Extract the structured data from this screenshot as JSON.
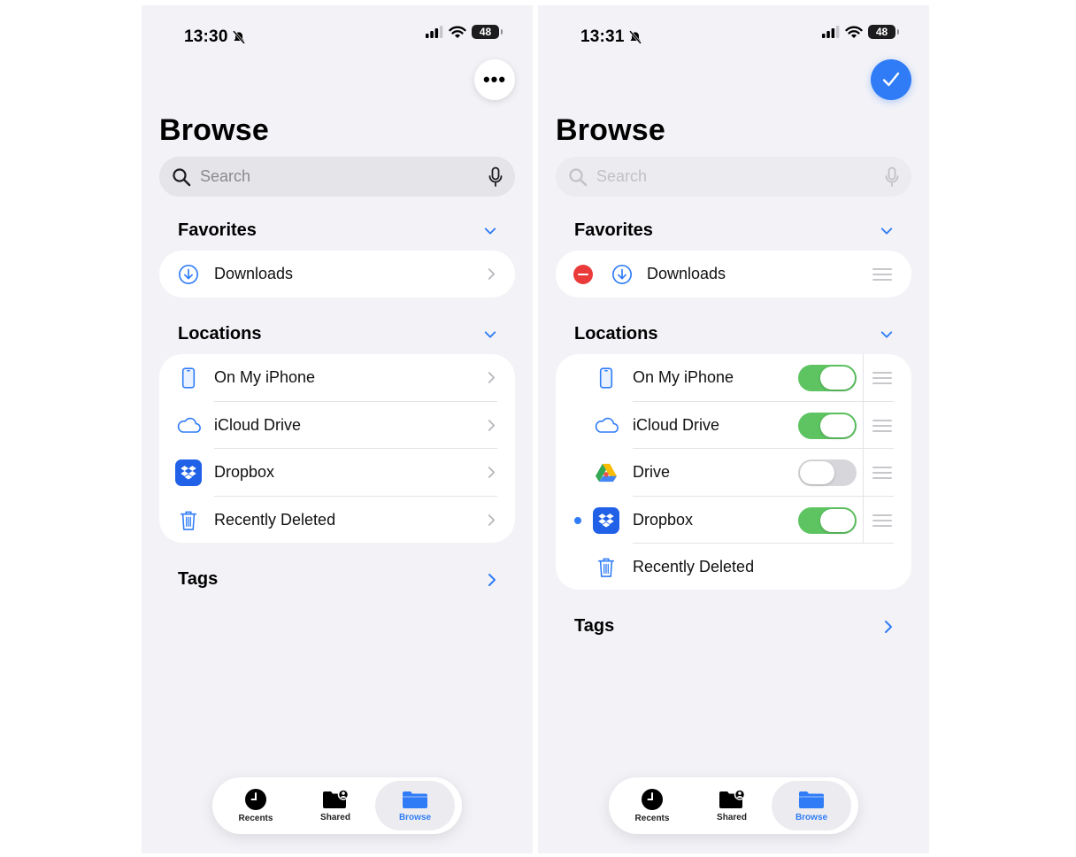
{
  "colors": {
    "accent": "#2f7cf6",
    "toggle_on": "#5dc461",
    "delete_red": "#ea3a3a",
    "background": "#f2f2f7"
  },
  "left_screen": {
    "status": {
      "time": "13:30",
      "battery": "48"
    },
    "title": "Browse",
    "search": {
      "placeholder": "Search"
    },
    "favorites": {
      "header": "Favorites",
      "items": [
        {
          "label": "Downloads",
          "icon": "download-icon"
        }
      ]
    },
    "locations": {
      "header": "Locations",
      "items": [
        {
          "label": "On My iPhone",
          "icon": "iphone-icon"
        },
        {
          "label": "iCloud Drive",
          "icon": "cloud-icon"
        },
        {
          "label": "Dropbox",
          "icon": "dropbox-icon"
        },
        {
          "label": "Recently Deleted",
          "icon": "trash-icon"
        }
      ]
    },
    "tags": {
      "header": "Tags"
    },
    "tabs": [
      {
        "label": "Recents"
      },
      {
        "label": "Shared"
      },
      {
        "label": "Browse",
        "active": true
      }
    ]
  },
  "right_screen": {
    "status": {
      "time": "13:31",
      "battery": "48"
    },
    "title": "Browse",
    "search": {
      "placeholder": "Search"
    },
    "favorites": {
      "header": "Favorites",
      "items": [
        {
          "label": "Downloads",
          "icon": "download-icon"
        }
      ]
    },
    "locations": {
      "header": "Locations",
      "items": [
        {
          "label": "On My iPhone",
          "icon": "iphone-icon",
          "enabled": true
        },
        {
          "label": "iCloud Drive",
          "icon": "cloud-icon",
          "enabled": true
        },
        {
          "label": "Drive",
          "icon": "google-drive-icon",
          "enabled": false
        },
        {
          "label": "Dropbox",
          "icon": "dropbox-icon",
          "enabled": true
        },
        {
          "label": "Recently Deleted",
          "icon": "trash-icon"
        }
      ]
    },
    "tags": {
      "header": "Tags"
    },
    "tabs": [
      {
        "label": "Recents"
      },
      {
        "label": "Shared"
      },
      {
        "label": "Browse",
        "active": true
      }
    ]
  }
}
